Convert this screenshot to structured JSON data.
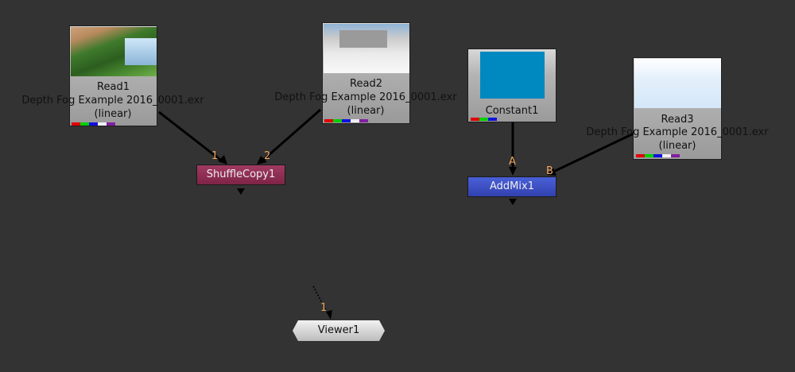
{
  "nodes": {
    "read1": {
      "title": "Read1",
      "file": "Depth Fog Example 2016_0001.exr",
      "colorspace": "(linear)"
    },
    "read2": {
      "title": "Read2",
      "file": "Depth Fog Example 2016_0001.exr",
      "colorspace": "(linear)"
    },
    "read3": {
      "title": "Read3",
      "file": "Depth Fog Example 2016_0001.exr",
      "colorspace": "(linear)"
    },
    "constant1": {
      "title": "Constant1",
      "color": "#0088c0"
    },
    "shufflecopy1": {
      "title": "ShuffleCopy1",
      "color": "#8e2a4e"
    },
    "addmix1": {
      "title": "AddMix1",
      "color": "#3a4fc0"
    },
    "viewer1": {
      "title": "Viewer1"
    }
  },
  "inputs": {
    "shuffle_in1": "1",
    "shuffle_in2": "2",
    "addmix_a": "A",
    "addmix_b": "B",
    "viewer_in1": "1"
  },
  "channel_colors": [
    "#e00000",
    "#00d000",
    "#1010e0",
    "#f0f0f0",
    "#8020a0"
  ],
  "colors": {
    "background": "#333333",
    "input_label": "#f0a860",
    "node_border": "#1e1e1e"
  }
}
